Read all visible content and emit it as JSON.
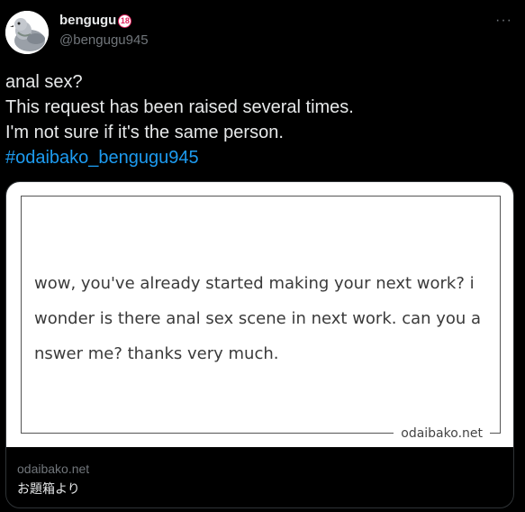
{
  "author": {
    "display_name": "bengugu",
    "age_badge": "18",
    "handle": "@bengugu945",
    "avatar_icon": "pigeon-avatar-icon"
  },
  "more_button": {
    "icon": "more-horizontal-icon",
    "label": "···"
  },
  "tweet": {
    "lines": [
      "anal sex?",
      "This request has been raised several times.",
      "I'm not sure if it's the same person."
    ],
    "hashtag": "#odaibako_bengugu945"
  },
  "card": {
    "question_lines": [
      "wow, you've already started making your next work? i",
      "wonder is there anal sex scene in next work. can you a",
      "nswer me? thanks very much."
    ],
    "image_site_label": "odaibako.net",
    "domain": "odaibako.net",
    "title": "お題箱より"
  },
  "colors": {
    "background": "#000000",
    "text": "#e7e9ea",
    "secondary": "#71767b",
    "link": "#1d9bf0",
    "badge": "#e0245e"
  }
}
